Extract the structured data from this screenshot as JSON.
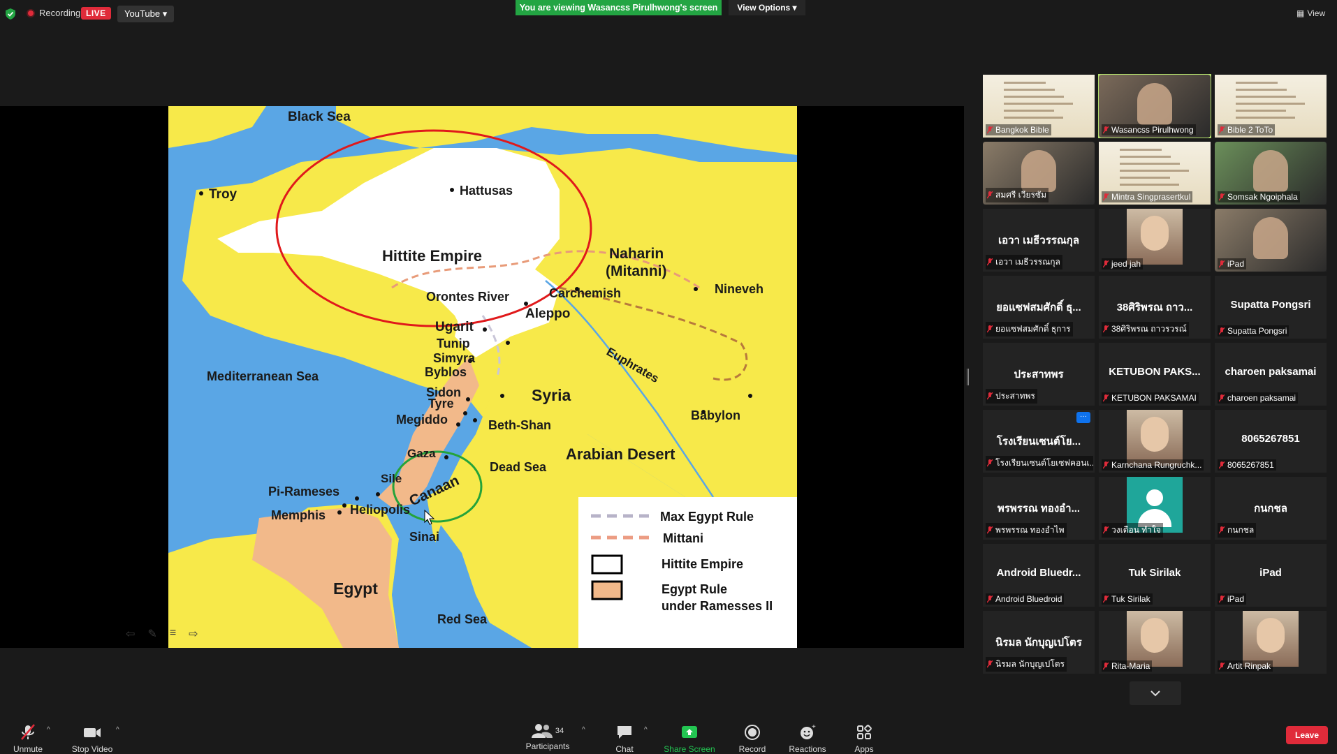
{
  "top": {
    "recording": "Recording",
    "live": "LIVE",
    "youtube": "YouTube",
    "banner": "You are viewing Wasancss Pirulhwong's screen",
    "view_options": "View Options",
    "view": "View"
  },
  "map": {
    "labels": {
      "black_sea": "Black Sea",
      "troy": "Troy",
      "hattusas": "Hattusas",
      "hittite_empire": "Hittite Empire",
      "naharin": "Naharin",
      "mitanni": "(Mitanni)",
      "nineveh": "Nineveh",
      "orontes": "Orontes River",
      "carchemish": "Carchemish",
      "aleppo": "Aleppo",
      "ugarit": "Ugarit",
      "tunip": "Tunip",
      "simyra": "Simyra",
      "byblos": "Byblos",
      "euphrates": "Euphrates",
      "mediterranean": "Mediterranean Sea",
      "sidon": "Sidon",
      "tyre": "Tyre",
      "syria": "Syria",
      "megiddo": "Megiddo",
      "beth_shan": "Beth-Shan",
      "babylon": "Babylon",
      "gaza": "Gaza",
      "arabian_desert": "Arabian Desert",
      "sile": "Sile",
      "canaan": "Canaan",
      "dead_sea": "Dead Sea",
      "pi_rameses": "Pi-Rameses",
      "memphis": "Memphis",
      "heliopolis": "Heliopolis",
      "sinai": "Sinai",
      "egypt": "Egypt",
      "red_sea": "Red Sea"
    },
    "legend": {
      "max_egypt": "Max Egypt Rule",
      "mittani": "Mittani",
      "hittite": "Hittite Empire",
      "egypt_rule_1": "Egypt Rule",
      "egypt_rule_2": "under Ramesses II"
    }
  },
  "participants": [
    {
      "big": "",
      "name": "Bangkok Bible",
      "kind": "poster"
    },
    {
      "big": "",
      "name": "Wasancss Pirulhwong",
      "kind": "video",
      "active": true
    },
    {
      "big": "",
      "name": "Bible 2 ToTo",
      "kind": "poster"
    },
    {
      "big": "",
      "name": "สมศรี เวียรซัม",
      "kind": "video"
    },
    {
      "big": "",
      "name": "Mintra Singprasertkul",
      "kind": "poster"
    },
    {
      "big": "",
      "name": "Somsak Ngoiphala",
      "kind": "video"
    },
    {
      "big": "เอวา เมธีวรรณกุล",
      "name": "เอวา เมธีวรรณกุล",
      "kind": "text"
    },
    {
      "big": "",
      "name": "jeed jah",
      "kind": "photo"
    },
    {
      "big": "",
      "name": "iPad",
      "kind": "video"
    },
    {
      "big": "ยอแซฟสมศักดิ์ ธุ...",
      "name": "ยอแซฟสมศักดิ์ ธุการ",
      "kind": "text"
    },
    {
      "big": "38ศิริพรณ ถาว...",
      "name": "38ศิริพรณ ถาวรวรณ์",
      "kind": "text"
    },
    {
      "big": "Supatta Pongsri",
      "name": "Supatta Pongsri",
      "kind": "text"
    },
    {
      "big": "ประสาทพร",
      "name": "ประสาทพร",
      "kind": "text"
    },
    {
      "big": "KETUBON PAKS...",
      "name": "KETUBON PAKSAMAI",
      "kind": "text"
    },
    {
      "big": "charoen paksamai",
      "name": "charoen paksamai",
      "kind": "text"
    },
    {
      "big": "โรงเรียนเซนต์โย...",
      "name": "โรงเรียนเซนต์โยเซฟคอนเ...",
      "kind": "text"
    },
    {
      "big": "",
      "name": "Karnchana Rungruchk...",
      "kind": "photo"
    },
    {
      "big": "8065267851",
      "name": "8065267851",
      "kind": "text"
    },
    {
      "big": "พรพรรณ ทองอำ...",
      "name": "พรพรรณ ทองอำไพ",
      "kind": "text"
    },
    {
      "big": "",
      "name": "วงเดือน ทำใจ",
      "kind": "avatar"
    },
    {
      "big": "กนกชล",
      "name": "กนกชล",
      "kind": "text"
    },
    {
      "big": "Android Bluedr...",
      "name": "Android Bluedroid",
      "kind": "text"
    },
    {
      "big": "Tuk Sirilak",
      "name": "Tuk Sirilak",
      "kind": "text"
    },
    {
      "big": "iPad",
      "name": "iPad",
      "kind": "text"
    },
    {
      "big": "นิรมล นักบุญเปโตร",
      "name": "นิรมล นักบุญเปโตร",
      "kind": "text"
    },
    {
      "big": "",
      "name": "Rita-Maria",
      "kind": "photo"
    },
    {
      "big": "",
      "name": "Artit Rinpak",
      "kind": "photo"
    }
  ],
  "toolbar": {
    "unmute": "Unmute",
    "stop_video": "Stop Video",
    "participants": "Participants",
    "participants_count": "34",
    "chat": "Chat",
    "share_screen": "Share Screen",
    "record": "Record",
    "reactions": "Reactions",
    "apps": "Apps",
    "leave": "Leave"
  }
}
